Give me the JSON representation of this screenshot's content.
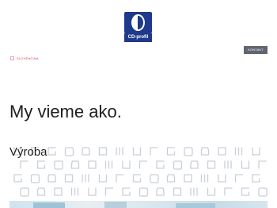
{
  "header": {
    "logo_text": "CD-profil",
    "contact_label": "KONTAKT",
    "language_label": "SLOVENČINA"
  },
  "hero": {
    "headline": "My vieme ako."
  },
  "section": {
    "title": "Výroba"
  },
  "colors": {
    "brand_blue": "#1f3a8c",
    "contact_bg": "#5f6570",
    "language_red": "#d23c57",
    "pattern_stroke": "#c9cfd8"
  },
  "icons": {
    "language": "flag-icon"
  }
}
